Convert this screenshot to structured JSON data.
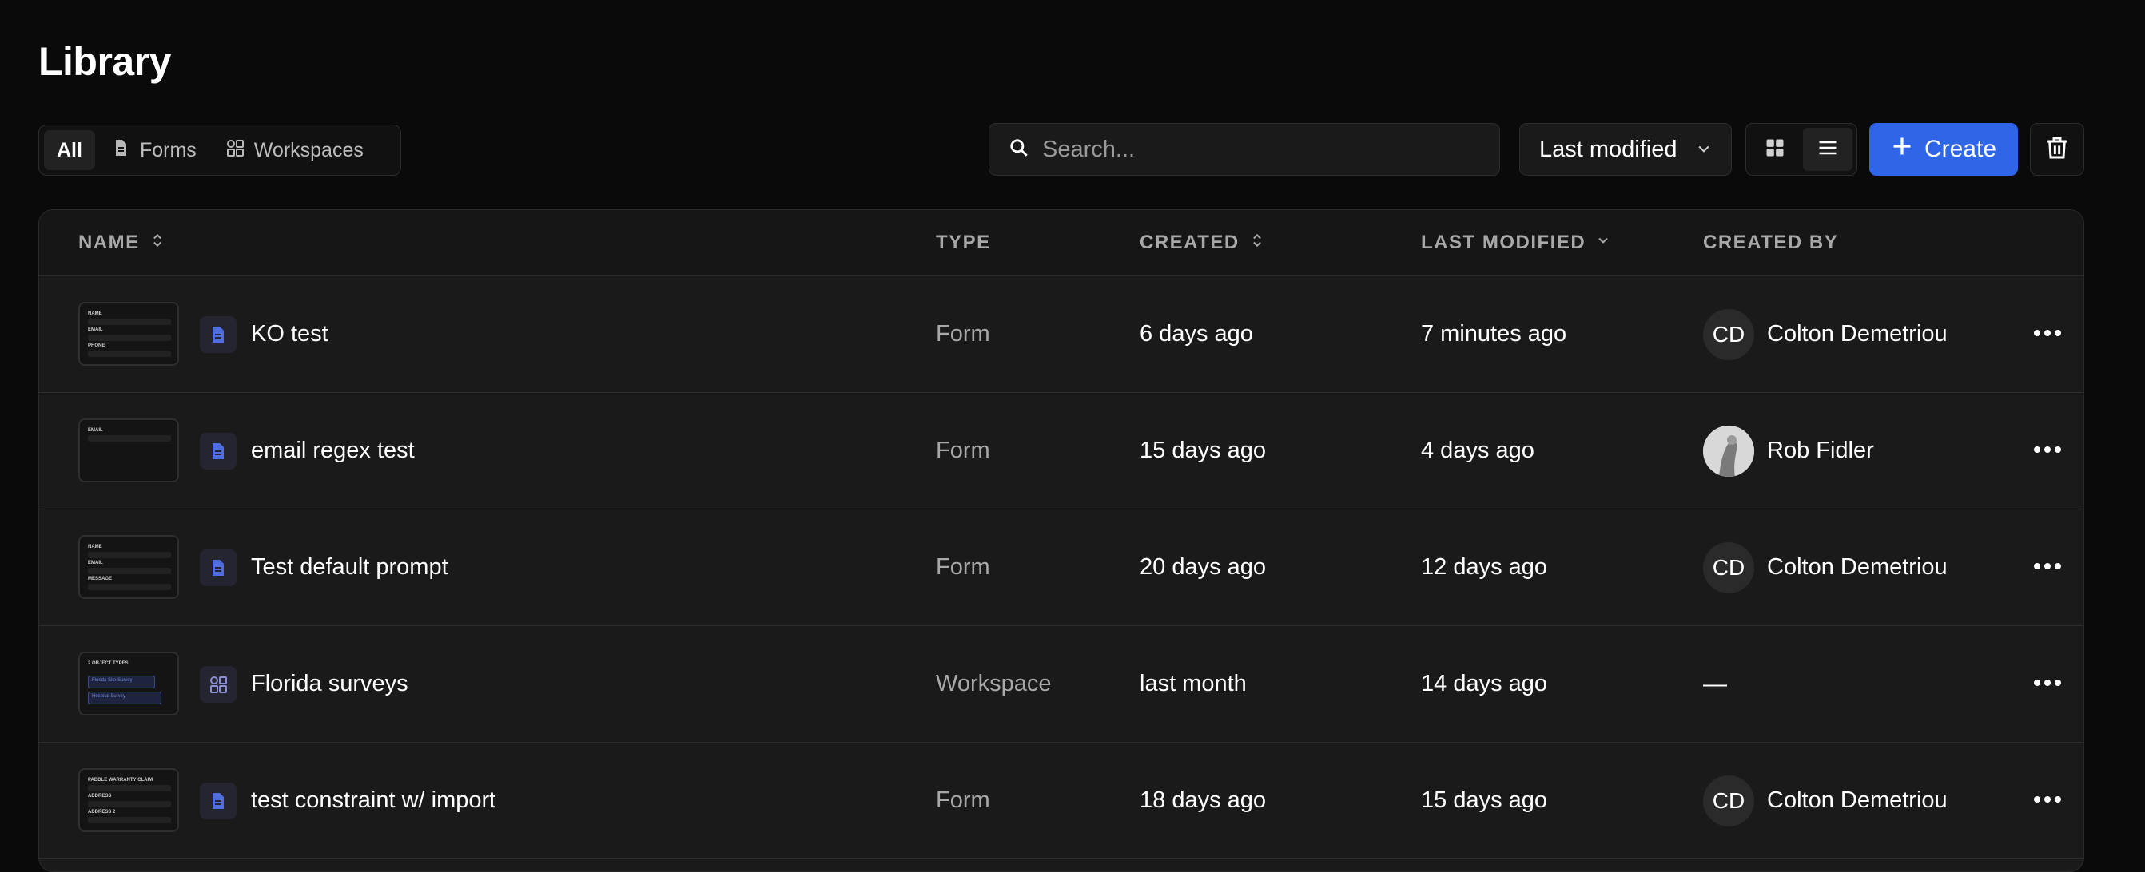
{
  "page": {
    "title": "Library"
  },
  "filters": [
    {
      "label": "All",
      "icon": "none",
      "active": true
    },
    {
      "label": "Forms",
      "icon": "document-icon",
      "active": false
    },
    {
      "label": "Workspaces",
      "icon": "workspace-icon",
      "active": false
    }
  ],
  "search": {
    "placeholder": "Search...",
    "value": ""
  },
  "sort": {
    "label": "Last modified"
  },
  "view": {
    "active": "list"
  },
  "create": {
    "label": "Create"
  },
  "table": {
    "headers": {
      "name": "NAME",
      "type": "TYPE",
      "created": "CREATED",
      "last_modified": "LAST MODIFIED",
      "created_by": "CREATED BY"
    },
    "rows": [
      {
        "name": "KO test",
        "type": "Form",
        "created": "6 days ago",
        "last_modified": "7 minutes ago",
        "created_by": "Colton Demetriou",
        "initials": "CD",
        "avatar": "initials",
        "icon": "document-icon",
        "thumb_labels": [
          "NAME",
          "EMAIL",
          "PHONE"
        ]
      },
      {
        "name": "email regex test",
        "type": "Form",
        "created": "15 days ago",
        "last_modified": "4 days ago",
        "created_by": "Rob Fidler",
        "initials": "",
        "avatar": "photo",
        "icon": "document-icon",
        "thumb_labels": [
          "EMAIL"
        ]
      },
      {
        "name": "Test default prompt",
        "type": "Form",
        "created": "20 days ago",
        "last_modified": "12 days ago",
        "created_by": "Colton Demetriou",
        "initials": "CD",
        "avatar": "initials",
        "icon": "document-icon",
        "thumb_labels": [
          "NAME",
          "EMAIL",
          "MESSAGE"
        ]
      },
      {
        "name": "Florida surveys",
        "type": "Workspace",
        "created": "last month",
        "last_modified": "14 days ago",
        "created_by": "—",
        "initials": "",
        "avatar": "none",
        "icon": "workspace-icon",
        "thumb_labels": [
          "2 OBJECT TYPES",
          "Florida Site Survey",
          "Hospital Survey"
        ]
      },
      {
        "name": "test constraint w/ import",
        "type": "Form",
        "created": "18 days ago",
        "last_modified": "15 days ago",
        "created_by": "Colton Demetriou",
        "initials": "CD",
        "avatar": "initials",
        "icon": "document-icon",
        "thumb_labels": [
          "PADDLE WARRANTY CLAIM",
          "ADDRESS",
          "ADDRESS 2"
        ]
      }
    ]
  },
  "colors": {
    "accent": "#2f66e8",
    "background": "#0a0a0a",
    "surface": "#1a1a1a",
    "icon_tint": "#4f6fe0"
  }
}
